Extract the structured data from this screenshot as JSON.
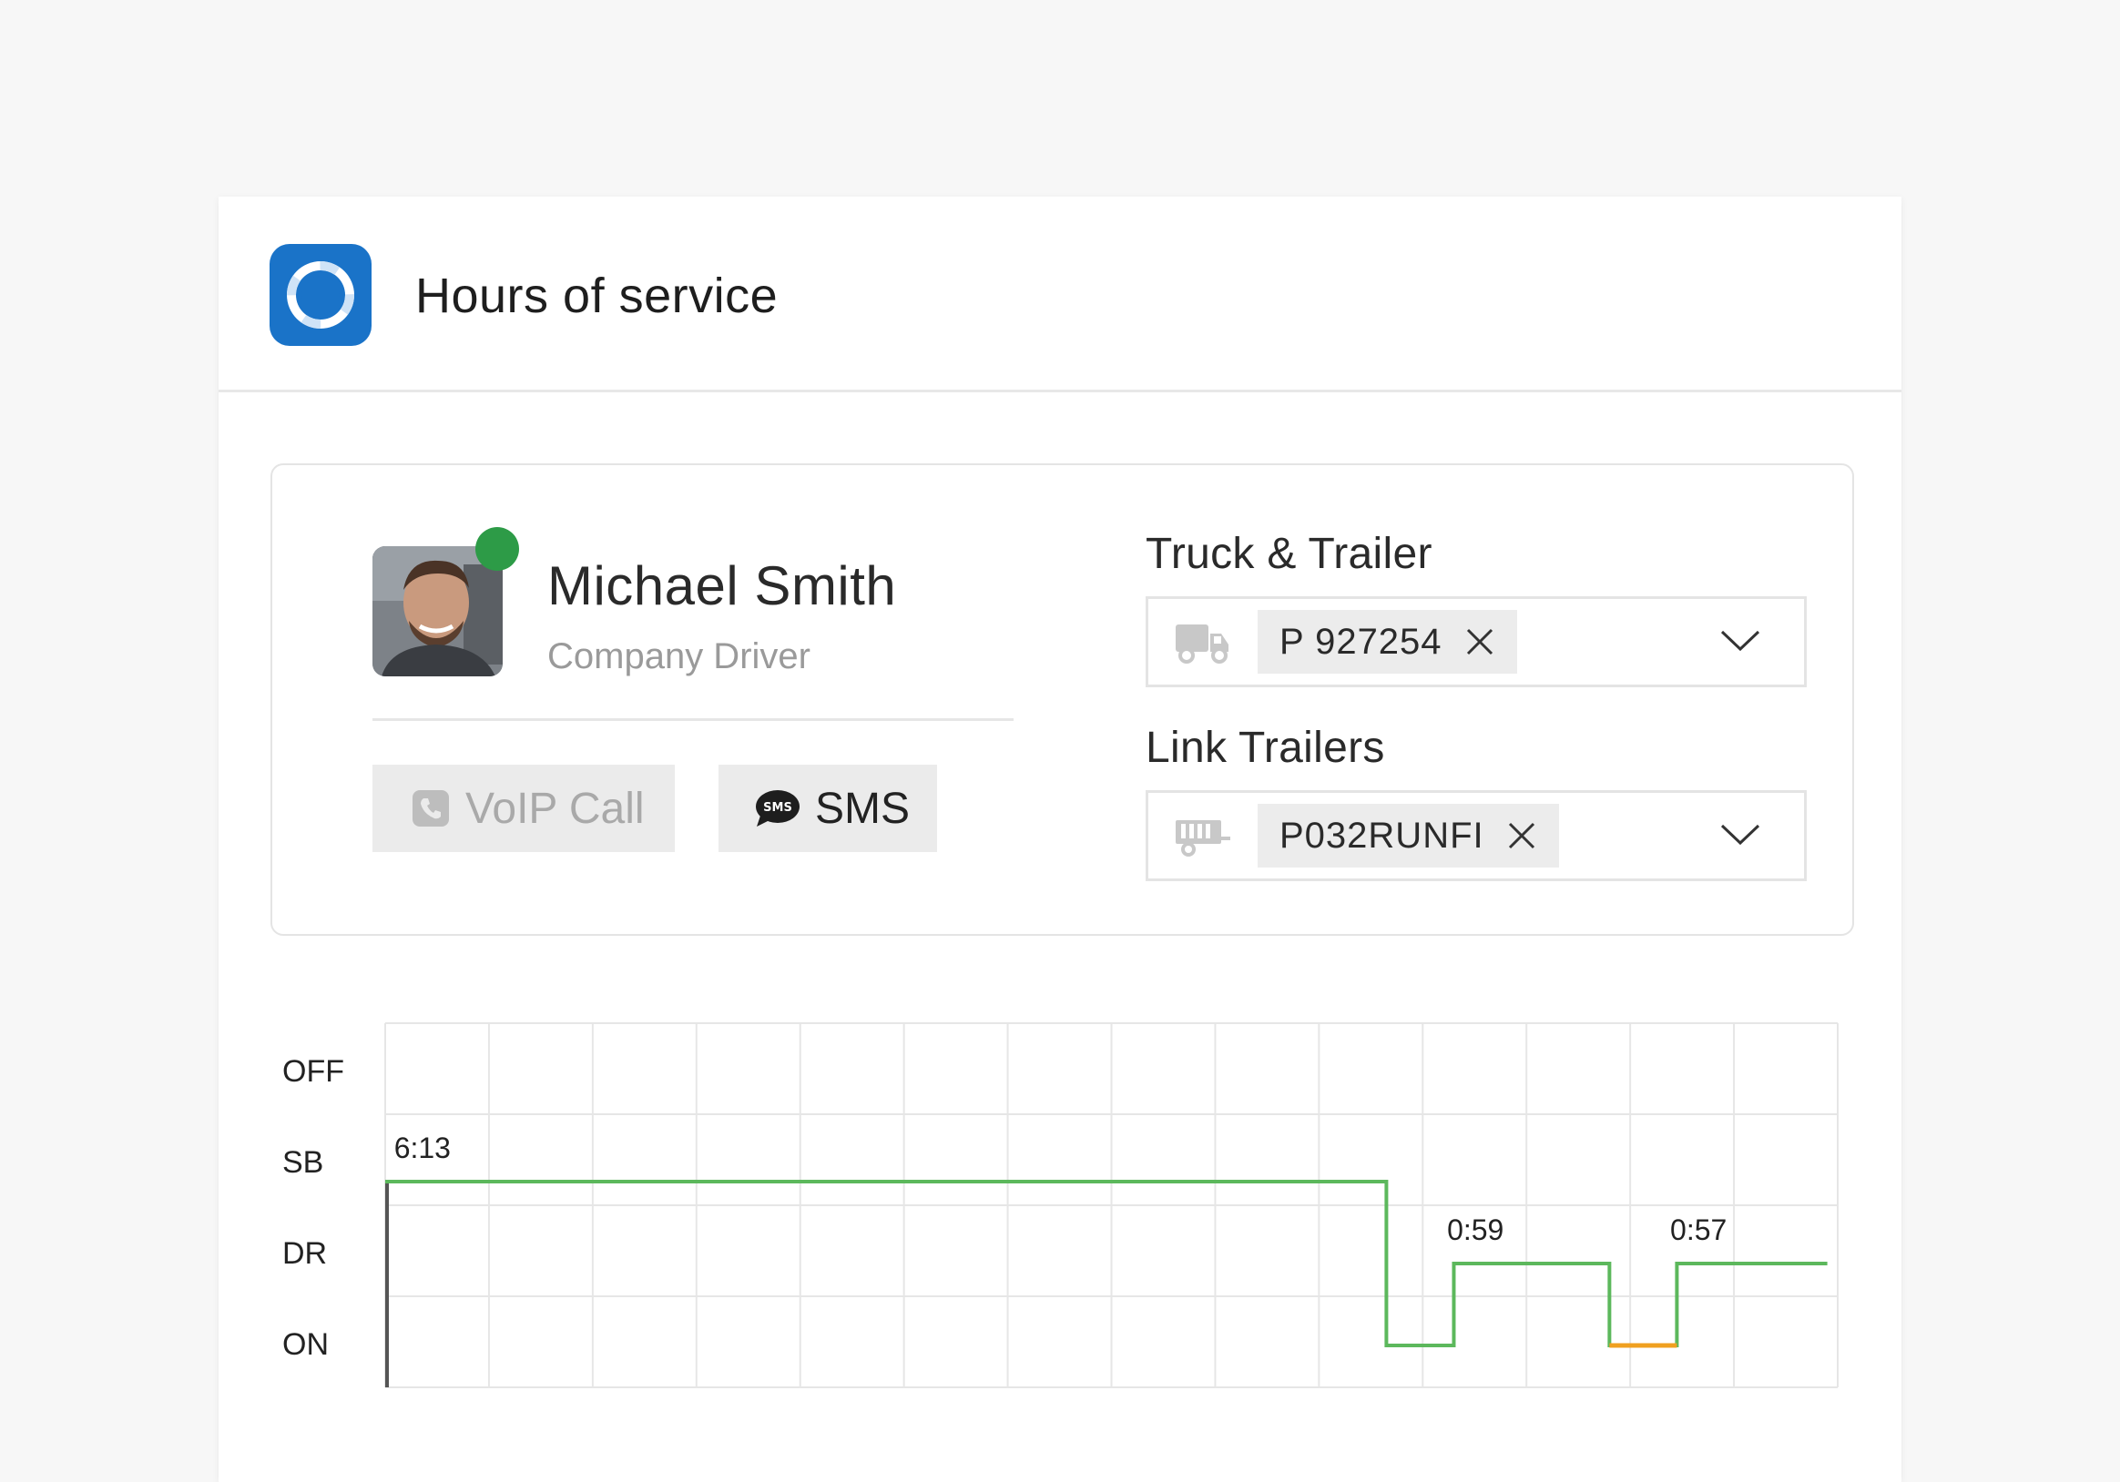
{
  "app": {
    "title": "Hours of service",
    "icon": "lifebuoy-icon",
    "accent_color": "#1a73c8"
  },
  "driver": {
    "name": "Michael Smith",
    "role": "Company Driver",
    "status_color": "#2d9b47",
    "avatar": "driver-photo"
  },
  "actions": {
    "voip_label": "VoIP Call",
    "voip_icon": "phone-icon",
    "sms_label": "SMS",
    "sms_icon": "sms-bubble-icon",
    "sms_icon_text": "SMS"
  },
  "truck": {
    "label": "Truck & Trailer",
    "icon": "truck-icon",
    "selected": "P 927254"
  },
  "trailers": {
    "label": "Link Trailers",
    "icon": "trailer-icon",
    "selected": "P032RUNFI"
  },
  "chart_data": {
    "type": "line",
    "title": "",
    "y_categories": [
      "OFF",
      "SB",
      "DR",
      "ON"
    ],
    "x_ticks": 14,
    "steps": [
      {
        "from": 0,
        "to": 9.65,
        "state": "SB"
      },
      {
        "from": 9.65,
        "to": 10.3,
        "state": "ON"
      },
      {
        "from": 10.3,
        "to": 11.8,
        "state": "DR"
      },
      {
        "from": 11.8,
        "to": 12.45,
        "state": "ON"
      },
      {
        "from": 12.45,
        "to": 13.9,
        "state": "DR"
      }
    ],
    "orange_segment": {
      "from": 11.8,
      "to": 12.45,
      "state": "ON"
    },
    "annotations": [
      {
        "text": "6:13",
        "x": 0.05,
        "state": "SB"
      },
      {
        "text": "0:59",
        "x": 10.2,
        "state": "DR"
      },
      {
        "text": "0:57",
        "x": 12.35,
        "state": "DR"
      }
    ],
    "line_color": "#5cb85c",
    "highlight_color": "#f0a020",
    "grid": true
  }
}
